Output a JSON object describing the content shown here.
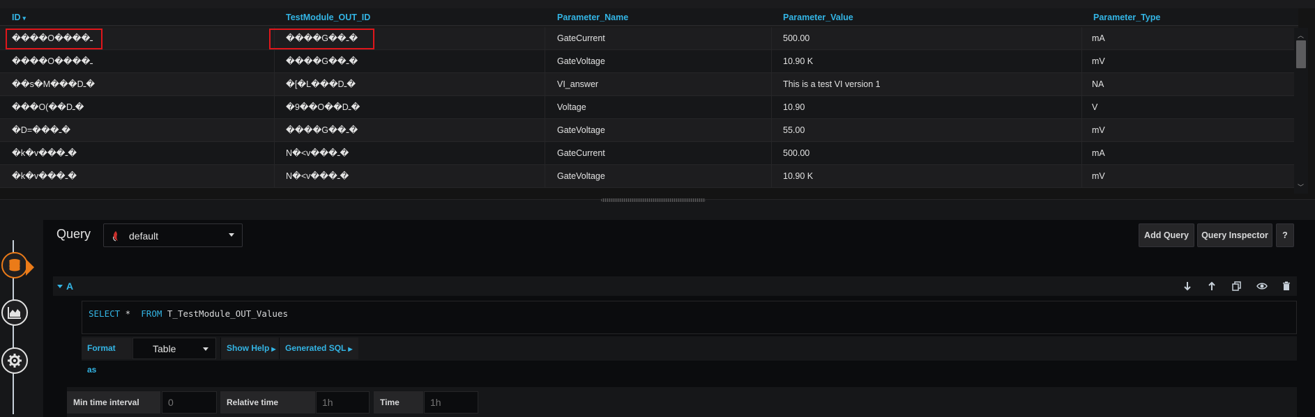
{
  "table": {
    "columns": [
      {
        "label": "ID",
        "sorted": true
      },
      {
        "label": "TestModule_OUT_ID"
      },
      {
        "label": "Parameter_Name"
      },
      {
        "label": "Parameter_Value"
      },
      {
        "label": "Parameter_Type"
      }
    ],
    "sort_indicator": "▾",
    "rows": [
      [
        "����O����ـ",
        "����G��ـ�",
        "GateCurrent",
        "500.00",
        "mA"
      ],
      [
        "����O����ـ",
        "����G��ـ�",
        "GateVoltage",
        "10.90 K",
        "mV"
      ],
      [
        "��s�M���Dـ�",
        "�[�L���Dـ�",
        "VI_answer",
        "This is a test VI version 1",
        "NA"
      ],
      [
        "���O(��Dـ�",
        "�9��O��Dـ�",
        "Voltage",
        "10.90",
        "V"
      ],
      [
        "�D=���ـ�",
        "����G��ـ�",
        "GateVoltage",
        "55.00",
        "mV"
      ],
      [
        "�k�v���ـ�",
        "N�<v���ـ�",
        "GateCurrent",
        "500.00",
        "mA"
      ],
      [
        "�k�v���ـ�",
        "N�<v���ـ�",
        "GateVoltage",
        "10.90 K",
        "mV"
      ]
    ]
  },
  "query": {
    "title": "Query",
    "datasource": "default",
    "add_query": "Add Query",
    "query_inspector": "Query Inspector",
    "help": "?",
    "row_letter": "A",
    "sql": {
      "kw1": "SELECT",
      "star": " *  ",
      "kw2": "FROM",
      "table": " T_TestModule_OUT_Values"
    },
    "format_as_label": "Format as",
    "format_value": "Table",
    "show_help": "Show Help",
    "generated_sql": "Generated SQL",
    "min_time_interval_label": "Min time interval",
    "min_time_interval_placeholder": "0",
    "relative_time_label": "Relative time",
    "relative_time_placeholder": "1h",
    "time_shift_label": "Time shift",
    "time_shift_placeholder": "1h"
  },
  "icons": {
    "rail": [
      "database-icon",
      "visualization-icon",
      "settings-gear-icon"
    ],
    "row_actions": [
      "move-down-icon",
      "move-up-icon",
      "duplicate-icon",
      "toggle-visibility-icon",
      "delete-icon"
    ]
  },
  "colors": {
    "accent": "#33b5e5",
    "active": "#eb7b18",
    "highlight": "#e0161b",
    "background": "#161719"
  }
}
